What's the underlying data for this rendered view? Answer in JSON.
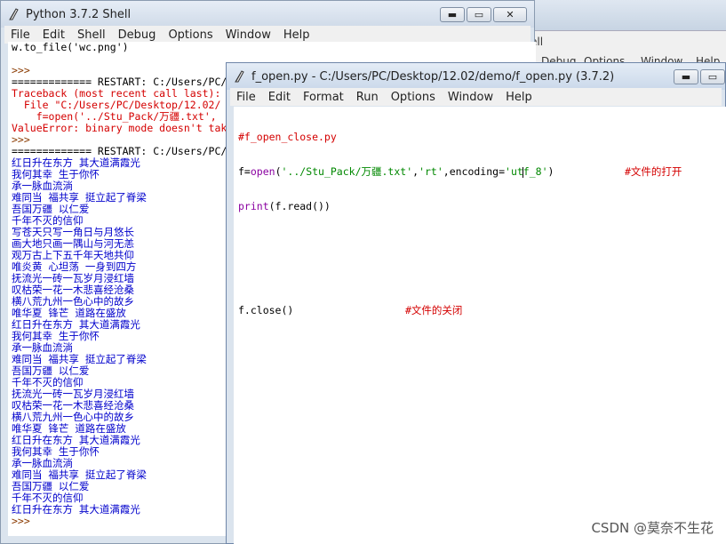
{
  "background_window": {
    "menu_fragment_1": "ell",
    "menu_fragment_2": "Debug",
    "menu_fragment_3": "Options",
    "menu_fragment_4": "Window",
    "menu_fragment_5": "Help"
  },
  "shell": {
    "title": "Python 3.7.2 Shell",
    "menu": [
      "File",
      "Edit",
      "Shell",
      "Debug",
      "Options",
      "Window",
      "Help"
    ],
    "lines": [
      {
        "text": "w.to_file('wc.png')",
        "color": "blk"
      },
      {
        "text": "",
        "color": "blk"
      },
      {
        "text": ">>>",
        "color": "prompt"
      },
      {
        "text": "============= RESTART: C:/Users/PC/",
        "color": "blk"
      },
      {
        "text": "Traceback (most recent call last):",
        "color": "red"
      },
      {
        "text": "  File \"C:/Users/PC/Desktop/12.02/",
        "color": "red"
      },
      {
        "text": "    f=open('../Stu_Pack/万疆.txt',",
        "color": "red"
      },
      {
        "text": "ValueError: binary mode doesn't tak",
        "color": "red"
      },
      {
        "text": ">>>",
        "color": "prompt"
      },
      {
        "text": "============= RESTART: C:/Users/PC/",
        "color": "blk"
      },
      {
        "text": "红日升在东方 其大道满霞光",
        "color": "blue"
      },
      {
        "text": "我何其幸 生于你怀",
        "color": "blue"
      },
      {
        "text": "承一脉血流淌",
        "color": "blue"
      },
      {
        "text": "难同当 福共享 挺立起了脊梁",
        "color": "blue"
      },
      {
        "text": "吾国万疆 以仁爱",
        "color": "blue"
      },
      {
        "text": "千年不灭的信仰",
        "color": "blue"
      },
      {
        "text": "写苍天只写一角日与月悠长",
        "color": "blue"
      },
      {
        "text": "画大地只画一隅山与河无恙",
        "color": "blue"
      },
      {
        "text": "观万古上下五千年天地共仰",
        "color": "blue"
      },
      {
        "text": "唯炎黄 心坦荡 一身到四方",
        "color": "blue"
      },
      {
        "text": "抚流光一砖一瓦岁月浸红墙",
        "color": "blue"
      },
      {
        "text": "叹枯荣一花一木悲喜经沧桑",
        "color": "blue"
      },
      {
        "text": "横八荒九州一色心中的故乡",
        "color": "blue"
      },
      {
        "text": "唯华夏 锋芒 道路在盛放",
        "color": "blue"
      },
      {
        "text": "红日升在东方 其大道满霞光",
        "color": "blue"
      },
      {
        "text": "我何其幸 生于你怀",
        "color": "blue"
      },
      {
        "text": "承一脉血流淌",
        "color": "blue"
      },
      {
        "text": "难同当 福共享 挺立起了脊梁",
        "color": "blue"
      },
      {
        "text": "吾国万疆 以仁爱",
        "color": "blue"
      },
      {
        "text": "千年不灭的信仰",
        "color": "blue"
      },
      {
        "text": "抚流光一砖一瓦岁月浸红墙",
        "color": "blue"
      },
      {
        "text": "叹枯荣一花一木悲喜经沧桑",
        "color": "blue"
      },
      {
        "text": "横八荒九州一色心中的故乡",
        "color": "blue"
      },
      {
        "text": "唯华夏 锋芒 道路在盛放",
        "color": "blue"
      },
      {
        "text": "红日升在东方 其大道满霞光",
        "color": "blue"
      },
      {
        "text": "我何其幸 生于你怀",
        "color": "blue"
      },
      {
        "text": "承一脉血流淌",
        "color": "blue"
      },
      {
        "text": "难同当 福共享 挺立起了脊梁",
        "color": "blue"
      },
      {
        "text": "吾国万疆 以仁爱",
        "color": "blue"
      },
      {
        "text": "千年不灭的信仰",
        "color": "blue"
      },
      {
        "text": "红日升在东方 其大道满霞光",
        "color": "blue"
      },
      {
        "text": ">>>",
        "color": "prompt"
      }
    ]
  },
  "editor": {
    "title": "f_open.py - C:/Users/PC/Desktop/12.02/demo/f_open.py (3.7.2)",
    "menu": [
      "File",
      "Edit",
      "Format",
      "Run",
      "Options",
      "Window",
      "Help"
    ],
    "code": {
      "line1": "#f_open_close.py",
      "line2_a": "f=",
      "line2_b": "open",
      "line2_c": "(",
      "line2_d": "'../Stu_Pack/万疆.txt'",
      "line2_e": ",",
      "line2_f": "'rt'",
      "line2_g": ",encoding=",
      "line2_h": "'ut",
      "line2_i": "f_8'",
      "line2_j": ")",
      "line2_comment": "#文件的打开",
      "line3_a": "print",
      "line3_b": "(f.read())",
      "line6": "f.close()",
      "line6_comment": "#文件的关闭"
    }
  },
  "watermark": "CSDN @莫奈不生花",
  "colors": {
    "error_red": "#d40000",
    "output_blue": "#0000cc",
    "builtin_purple": "#8a00a0",
    "string_green": "#008800",
    "comment_red": "#d40000"
  }
}
